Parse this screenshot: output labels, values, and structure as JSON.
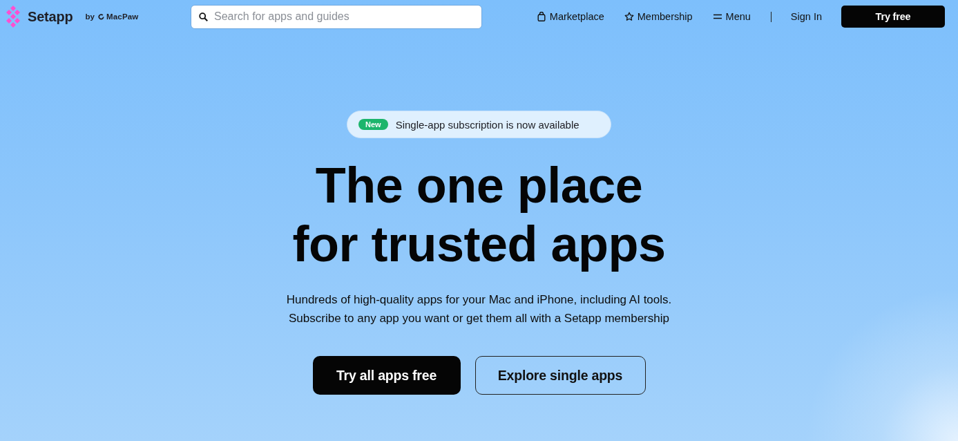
{
  "header": {
    "logo": {
      "name": "Setapp",
      "byline": "by",
      "maker": "MacPaw"
    },
    "search": {
      "placeholder": "Search for apps and guides"
    },
    "nav": [
      {
        "label": "Marketplace",
        "kind": "bag"
      },
      {
        "label": "Membership",
        "kind": "star"
      },
      {
        "label": "Menu",
        "kind": "menu"
      }
    ],
    "sign_in": "Sign In",
    "cta": "Try free"
  },
  "hero": {
    "announcement": {
      "badge": "New",
      "text": "Single-app subscription is now available"
    },
    "heading": [
      "The one place",
      "for trusted apps"
    ],
    "subtitle": [
      "Hundreds of high-quality apps for your Mac and iPhone, including AI tools.",
      "Subscribe to any app you want or get them all with a Setapp membership"
    ],
    "buttons": [
      {
        "label": "Try all apps free",
        "kind": "primary"
      },
      {
        "label": "Explore single apps",
        "kind": "secondary"
      }
    ]
  }
}
